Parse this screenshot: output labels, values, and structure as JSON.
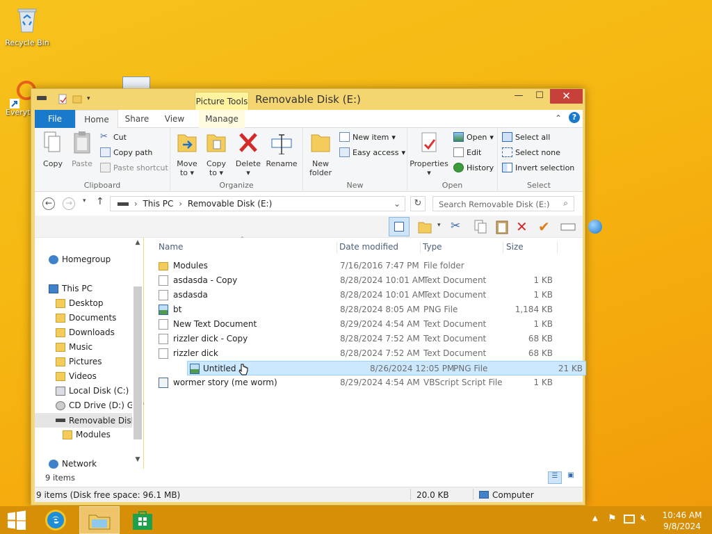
{
  "desktop": {
    "recycle_bin": "Recycle Bin",
    "everything_label": "Everyt"
  },
  "window": {
    "title": "Removable Disk (E:)",
    "contextual_tab": "Picture Tools",
    "min_glyph": "—",
    "max_glyph": "☐",
    "close_glyph": "✕"
  },
  "ribbon": {
    "tabs": [
      "File",
      "Home",
      "Share",
      "View",
      "Manage"
    ],
    "clipboard": {
      "copy": "Copy",
      "paste": "Paste",
      "cut": "Cut",
      "copy_path": "Copy path",
      "paste_shortcut": "Paste shortcut",
      "label": "Clipboard"
    },
    "organize": {
      "move_to": "Move to",
      "copy_to": "Copy to",
      "delete": "Delete",
      "rename": "Rename",
      "label": "Organize"
    },
    "new": {
      "new_folder": "New folder",
      "new_item": "New item",
      "easy_access": "Easy access",
      "label": "New"
    },
    "open": {
      "properties": "Properties",
      "open": "Open",
      "edit": "Edit",
      "history": "History",
      "label": "Open"
    },
    "select": {
      "select_all": "Select all",
      "select_none": "Select none",
      "invert": "Invert selection",
      "label": "Select"
    }
  },
  "address": {
    "path": [
      "This PC",
      "Removable Disk (E:)"
    ],
    "search_placeholder": "Search Removable Disk (E:)"
  },
  "nav": {
    "homegroup": "Homegroup",
    "this_pc": "This PC",
    "desktop": "Desktop",
    "documents": "Documents",
    "downloads": "Downloads",
    "music": "Music",
    "pictures": "Pictures",
    "videos": "Videos",
    "local_disk": "Local Disk (C:)",
    "cd_drive": "CD Drive (D:) GSP",
    "removable": "Removable Disk (",
    "modules": "Modules",
    "network": "Network"
  },
  "files": {
    "columns": [
      "Name",
      "Date modified",
      "Type",
      "Size"
    ],
    "rows": [
      {
        "name": "Modules",
        "date": "7/16/2016 7:47 PM",
        "type": "File folder",
        "size": ""
      },
      {
        "name": "asdasda - Copy",
        "date": "8/28/2024 10:01 AM",
        "type": "Text Document",
        "size": "1 KB"
      },
      {
        "name": "asdasda",
        "date": "8/28/2024 10:01 AM",
        "type": "Text Document",
        "size": "1 KB"
      },
      {
        "name": "bt",
        "date": "8/28/2024 8:05 AM",
        "type": "PNG File",
        "size": "1,184 KB"
      },
      {
        "name": "New Text Document",
        "date": "8/29/2024 4:54 AM",
        "type": "Text Document",
        "size": "1 KB"
      },
      {
        "name": "rizzler dick - Copy",
        "date": "8/28/2024 7:52 AM",
        "type": "Text Document",
        "size": "68 KB"
      },
      {
        "name": "rizzler dick",
        "date": "8/28/2024 7:52 AM",
        "type": "Text Document",
        "size": "68 KB"
      },
      {
        "name": "Untitled",
        "date": "8/26/2024 12:05 PM",
        "type": "PNG File",
        "size": "21 KB"
      },
      {
        "name": "wormer story (me worm)",
        "date": "8/29/2024 4:54 AM",
        "type": "VBScript Script File",
        "size": "1 KB"
      }
    ],
    "selected": "Untitled"
  },
  "status": {
    "item_count": "9 items",
    "details": "9 items (Disk free space: 96.1 MB)",
    "size": "20.0 KB",
    "location": "Computer"
  },
  "taskbar": {
    "time": "10:46 AM",
    "date": "9/8/2024"
  }
}
